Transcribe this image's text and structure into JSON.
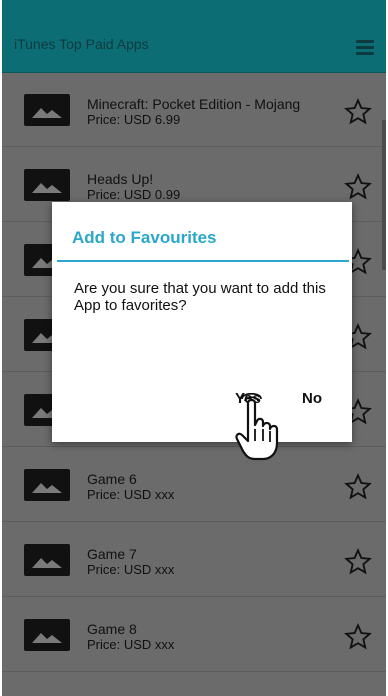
{
  "header": {
    "title": "iTunes Top Paid Apps",
    "menu_icon": "hamburger-menu-icon"
  },
  "apps": [
    {
      "title": "Minecraft: Pocket Edition - Mojang",
      "price": "Price: USD 6.99"
    },
    {
      "title": "Heads Up!",
      "price": "Price: USD 0.99"
    },
    {
      "title": "",
      "price": ""
    },
    {
      "title": "",
      "price": ""
    },
    {
      "title": "",
      "price": ""
    },
    {
      "title": "Game 6",
      "price": "Price: USD xxx"
    },
    {
      "title": "Game 7",
      "price": "Price: USD xxx"
    },
    {
      "title": "Game 8",
      "price": "Price: USD xxx"
    }
  ],
  "dialog": {
    "title": "Add to Favourites",
    "message": "Are you sure that you want to add this App to favorites?",
    "yes_label": "Yes",
    "no_label": "No"
  },
  "colors": {
    "appbar": "#0d6d74",
    "accent": "#2aa7cc",
    "list_background": "#6b6b6b"
  }
}
